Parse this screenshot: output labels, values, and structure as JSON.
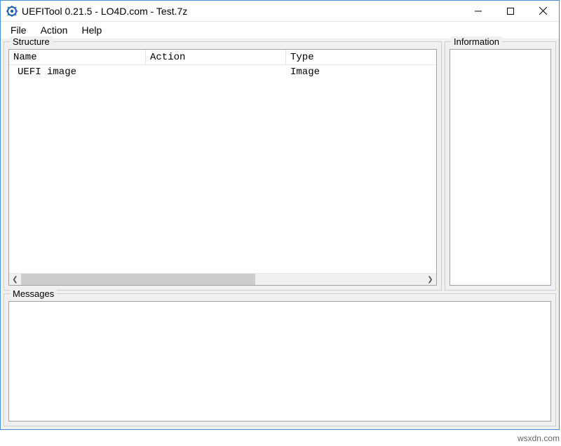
{
  "window": {
    "title": "UEFITool 0.21.5 - LO4D.com - Test.7z"
  },
  "menu": {
    "file": "File",
    "action": "Action",
    "help": "Help"
  },
  "panels": {
    "structure": "Structure",
    "information": "Information",
    "messages": "Messages"
  },
  "tree": {
    "headers": {
      "name": "Name",
      "action": "Action",
      "type": "Type"
    },
    "rows": [
      {
        "name": "UEFI image",
        "action": "",
        "type": "Image"
      }
    ]
  },
  "watermark": "wsxdn.com"
}
